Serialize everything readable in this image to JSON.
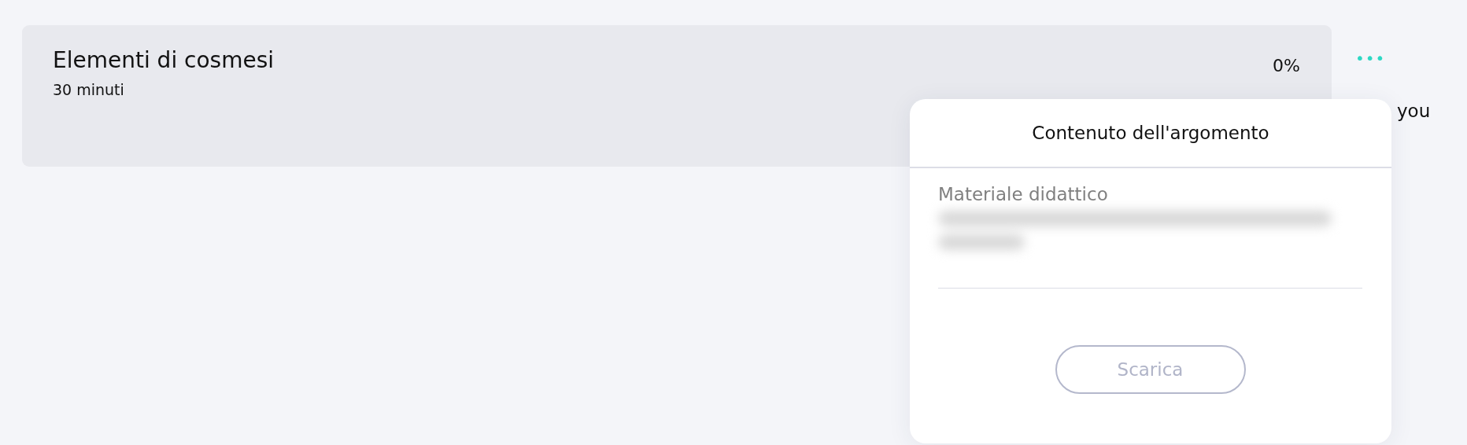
{
  "topic_card": {
    "title": "Elementi di cosmesi",
    "duration": "30 minuti",
    "progress": "0%"
  },
  "more_menu": {
    "label": "•••"
  },
  "behind_text": "you",
  "popup": {
    "title": "Contenuto dell'argomento",
    "section_label": "Materiale didattico",
    "file_name_redacted": true,
    "button": {
      "label": "Scarica",
      "disabled": true
    }
  }
}
